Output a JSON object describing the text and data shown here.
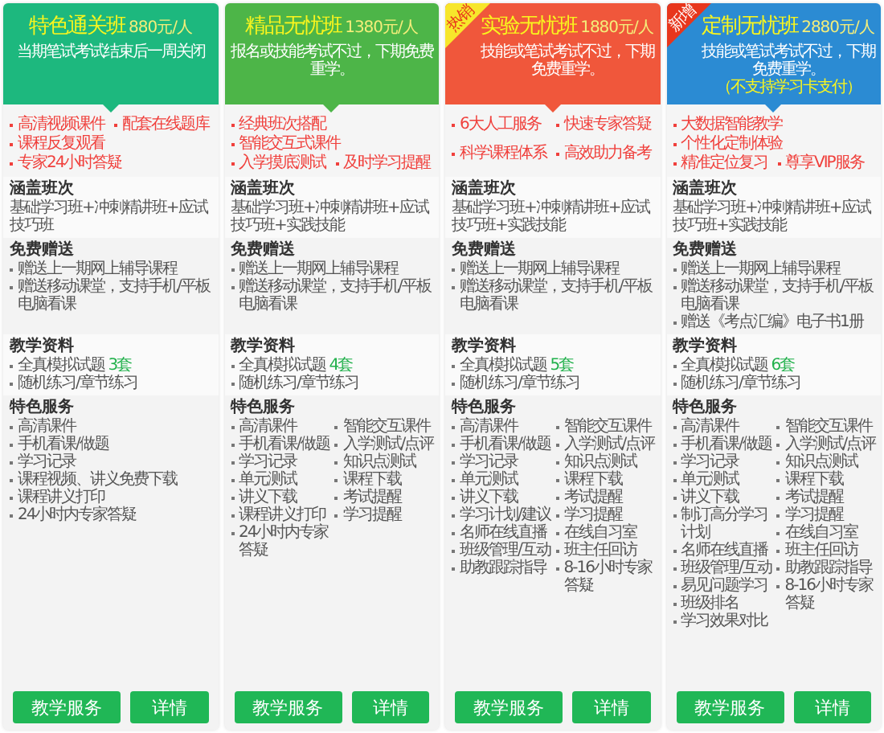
{
  "plans": [
    {
      "color": "#1db87e",
      "title": "特色通关班",
      "price": "880元/人",
      "notes": [
        {
          "kind": "plain",
          "text": "当期笔试考试结束后一周关闭"
        }
      ],
      "features": [
        "高清视频课件",
        "配套在线题库",
        "课程反复观看",
        "专家24小时答疑"
      ],
      "coverage": {
        "heading": "涵盖班次",
        "text": "基础学习班+冲刺精讲班+应试技巧班"
      },
      "gifts": {
        "heading": "免费赠送",
        "items": [
          "赠送上一期网上辅导课程",
          "赠送移动课堂，支持手机/平板电脑看课"
        ]
      },
      "materials": {
        "heading": "教学资料",
        "items": [
          {
            "text": "全真模拟试题",
            "count": "3套"
          },
          {
            "text": "随机练习/章节练习"
          }
        ]
      },
      "services": {
        "heading": "特色服务",
        "columns": [
          [
            "高清课件",
            "手机看课/做题",
            "学习记录",
            "课程视频、讲义免费下载",
            "课程讲义打印",
            "24小时内专家答疑"
          ]
        ]
      },
      "buttons": [
        "教学服务",
        "详情"
      ]
    },
    {
      "color": "#4db548",
      "title": "精品无忧班",
      "price": "1380元/人",
      "notes": [
        {
          "kind": "plain",
          "text": "报名或技能考试不过，下期免费重学。"
        }
      ],
      "features": [
        "经典班次搭配",
        "智能交互式课件",
        "入学摸底测试",
        "及时学习提醒"
      ],
      "coverage": {
        "heading": "涵盖班次",
        "text": "基础学习班+冲刺精讲班+应试技巧班+实践技能"
      },
      "gifts": {
        "heading": "免费赠送",
        "items": [
          "赠送上一期网上辅导课程",
          "赠送移动课堂，支持手机/平板电脑看课"
        ]
      },
      "materials": {
        "heading": "教学资料",
        "items": [
          {
            "text": "全真模拟试题",
            "count": "4套"
          },
          {
            "text": "随机练习/章节练习"
          }
        ]
      },
      "services": {
        "heading": "特色服务",
        "columns": [
          [
            "高清课件",
            "手机看课/做题",
            "学习记录",
            "单元测试",
            "讲义下载",
            "课程讲义打印",
            "24小时内专家答疑"
          ],
          [
            "智能交互课件",
            "入学测试/点评",
            "知识点测试",
            "课程下载",
            "考试提醒",
            "学习提醒"
          ]
        ]
      },
      "buttons": [
        "教学服务",
        "详情"
      ]
    },
    {
      "color": "#f0573b",
      "badge": {
        "kind": "hot",
        "text": "热销"
      },
      "title": "实验无忧班",
      "price": "1880元/人",
      "notes": [
        {
          "kind": "plain",
          "text": "技能或笔试考试不过，下期免费重学。"
        }
      ],
      "features": [
        "6大人工服务",
        "快速专家答疑",
        "科学课程体系",
        "高效助力备考"
      ],
      "coverage": {
        "heading": "涵盖班次",
        "text": "基础学习班+冲刺精讲班+应试技巧班+实践技能"
      },
      "gifts": {
        "heading": "免费赠送",
        "items": [
          "赠送上一期网上辅导课程",
          "赠送移动课堂，支持手机/平板电脑看课"
        ]
      },
      "materials": {
        "heading": "教学资料",
        "items": [
          {
            "text": "全真模拟试题",
            "count": "5套"
          },
          {
            "text": "随机练习/章节练习"
          }
        ]
      },
      "services": {
        "heading": "特色服务",
        "columns": [
          [
            "高清课件",
            "手机看课/做题",
            "学习记录",
            "单元测试",
            "讲义下载",
            "学习计划/建议",
            "名师在线直播",
            "班级管理/互动",
            "助教跟踪指导"
          ],
          [
            "智能交互课件",
            "入学测试/点评",
            "知识点测试",
            "课程下载",
            "考试提醒",
            "学习提醒",
            "在线自习室",
            "班主任回访",
            "8-16小时专家答疑"
          ]
        ]
      },
      "buttons": [
        "教学服务",
        "详情"
      ]
    },
    {
      "color": "#2b8bd3",
      "badge": {
        "kind": "new",
        "text": "新增"
      },
      "title": "定制无忧班",
      "price": "2880元/人",
      "notes": [
        {
          "kind": "plain",
          "text": "技能或笔试考试不过，下期免费重学。"
        },
        {
          "kind": "highlight",
          "text": "（不支持学习卡支付）"
        }
      ],
      "features": [
        "大数据智能教学",
        "个性化定制体验",
        "精准定位复习",
        "尊享VIP服务"
      ],
      "coverage": {
        "heading": "涵盖班次",
        "text": "基础学习班+冲刺精讲班+应试技巧班+实践技能"
      },
      "gifts": {
        "heading": "免费赠送",
        "items": [
          "赠送上一期网上辅导课程",
          "赠送移动课堂，支持手机/平板电脑看课",
          "赠送《考点汇编》电子书1册"
        ]
      },
      "materials": {
        "heading": "教学资料",
        "items": [
          {
            "text": "全真模拟试题",
            "count": "6套"
          },
          {
            "text": "随机练习/章节练习"
          }
        ]
      },
      "services": {
        "heading": "特色服务",
        "columns": [
          [
            "高清课件",
            "手机看课/做题",
            "学习记录",
            "单元测试",
            "讲义下载",
            "制订高分学习计划",
            "名师在线直播",
            "班级管理/互动",
            "易见问题学习",
            "班级排名",
            "学习效果对比"
          ],
          [
            "智能交互课件",
            "入学测试/点评",
            "知识点测试",
            "课程下载",
            "考试提醒",
            "学习提醒",
            "在线自习室",
            "班主任回访",
            "助教跟踪指导",
            "8-16小时专家答疑"
          ]
        ]
      },
      "buttons": [
        "教学服务",
        "详情"
      ]
    }
  ]
}
